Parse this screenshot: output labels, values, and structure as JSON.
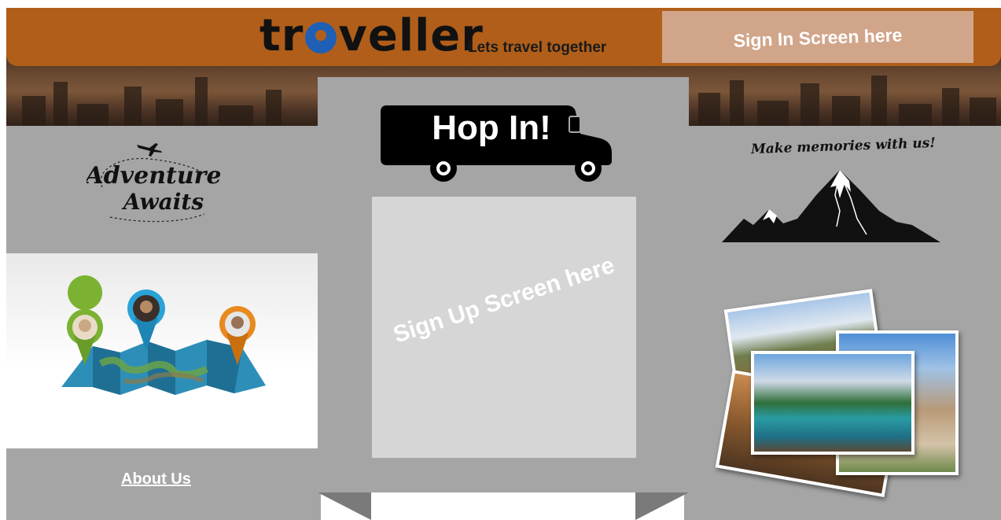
{
  "header": {
    "brand_prefix": "tr",
    "brand_suffix": "veller",
    "tagline": "Lets travel together",
    "sign_in_label": "Sign In Screen here"
  },
  "left": {
    "adventure_line1": "Adventure",
    "adventure_line2": "Awaits",
    "about_label": "About Us"
  },
  "center": {
    "bus_label": "Hop In!",
    "signup_placeholder": "Sign Up Screen here"
  },
  "right": {
    "memories_text": "Make memories with us!"
  },
  "colors": {
    "header_brown": "#b05e1a",
    "sign_in_bg": "#d1a58a",
    "panel_gray": "#a5a5a5",
    "signup_box": "#d6d6d6",
    "brand_blue": "#1f5fb5"
  },
  "icons": {
    "bus": "bus-icon",
    "mountain": "mountain-icon",
    "map": "map-with-pins-icon",
    "airplane": "airplane-icon"
  }
}
